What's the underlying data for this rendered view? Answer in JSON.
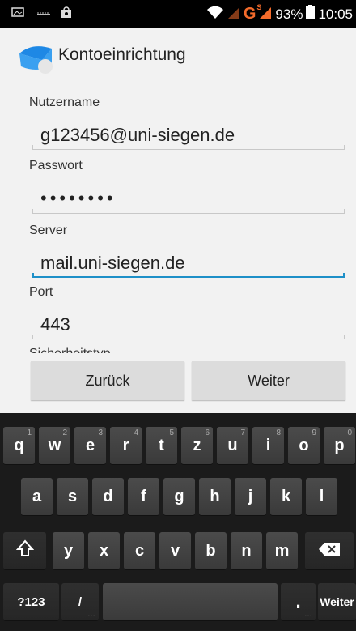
{
  "status_bar": {
    "battery": "93%",
    "time": "10:05",
    "network": "G",
    "network_sup": "S"
  },
  "app": {
    "title": "Kontoeinrichtung"
  },
  "form": {
    "username_label": "Nutzername",
    "username_value": "g123456@uni-siegen.de",
    "password_label": "Passwort",
    "password_value": "••••••••",
    "server_label": "Server",
    "server_value": "mail.uni-siegen.de",
    "port_label": "Port",
    "port_value": "443",
    "security_label": "Sicherheitstyp"
  },
  "buttons": {
    "back": "Zurück",
    "next": "Weiter"
  },
  "keyboard": {
    "row1": [
      {
        "key": "q",
        "hint": "1"
      },
      {
        "key": "w",
        "hint": "2"
      },
      {
        "key": "e",
        "hint": "3"
      },
      {
        "key": "r",
        "hint": "4"
      },
      {
        "key": "t",
        "hint": "5"
      },
      {
        "key": "z",
        "hint": "6"
      },
      {
        "key": "u",
        "hint": "7"
      },
      {
        "key": "i",
        "hint": "8"
      },
      {
        "key": "o",
        "hint": "9"
      },
      {
        "key": "p",
        "hint": "0"
      }
    ],
    "row2": [
      "a",
      "s",
      "d",
      "f",
      "g",
      "h",
      "j",
      "k",
      "l"
    ],
    "row3": [
      "y",
      "x",
      "c",
      "v",
      "b",
      "n",
      "m"
    ],
    "symbols": "?123",
    "slash": "/",
    "period": ".",
    "enter": "Weiter",
    "ellipsis": "…"
  }
}
